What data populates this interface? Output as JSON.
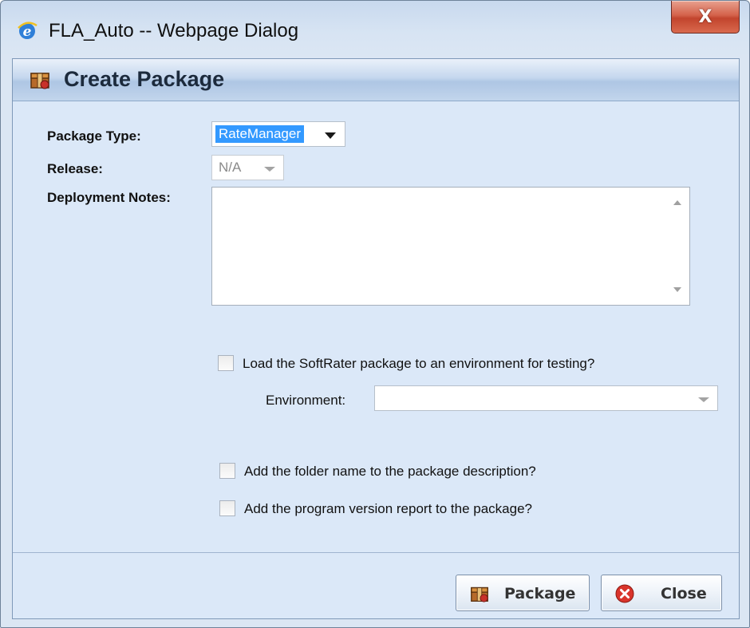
{
  "window": {
    "title": "FLA_Auto -- Webpage Dialog",
    "close_glyph": "X"
  },
  "dialog": {
    "title": "Create Package"
  },
  "form": {
    "package_type_label": "Package Type:",
    "package_type_value": "RateManager",
    "release_label": "Release:",
    "release_value": "N/A",
    "deployment_notes_label": "Deployment Notes:",
    "deployment_notes_value": "",
    "load_softrater_label": "Load the SoftRater package to an environment for testing?",
    "environment_label": "Environment:",
    "environment_value": "",
    "add_folder_label": "Add the folder name to the package description?",
    "add_version_label": "Add the program version report to the package?"
  },
  "buttons": {
    "package_label": "Package",
    "close_label": "Close"
  },
  "icons": {
    "window": "ie-icon",
    "header": "package-icon",
    "package_button": "package-icon",
    "close_button": "close-circle-icon"
  },
  "colors": {
    "selection": "#3399ff",
    "panel": "#dbe8f8",
    "close_red": "#c2442d"
  }
}
